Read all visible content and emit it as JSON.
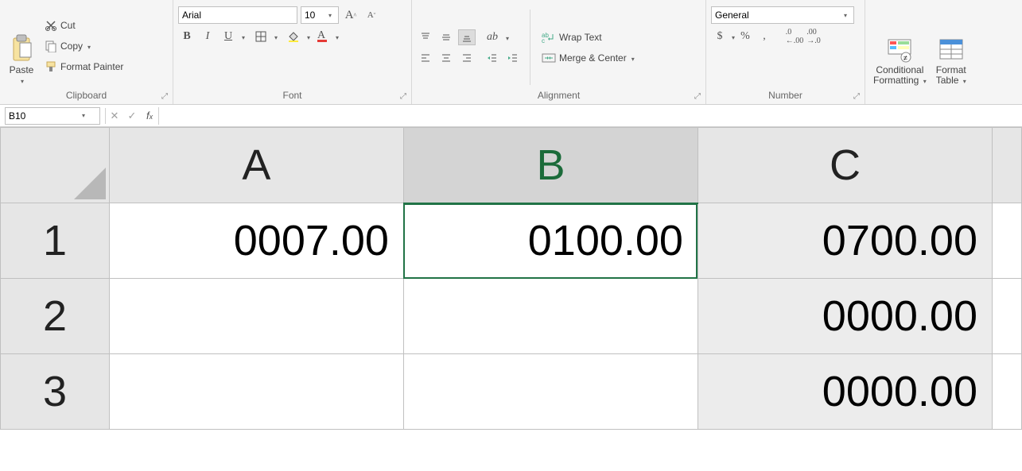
{
  "ribbon": {
    "clipboard": {
      "paste": "Paste",
      "cut": "Cut",
      "copy": "Copy",
      "format_painter": "Format Painter",
      "group_label": "Clipboard"
    },
    "font": {
      "font_name": "Arial",
      "font_size": "10",
      "group_label": "Font"
    },
    "alignment": {
      "wrap": "Wrap Text",
      "merge": "Merge & Center",
      "group_label": "Alignment"
    },
    "number": {
      "format": "General",
      "currency": "$",
      "percent": "%",
      "comma": ",",
      "group_label": "Number"
    },
    "styles": {
      "conditional": "Conditional\nFormatting",
      "format_table": "Format\nTable"
    }
  },
  "name_box": "B10",
  "formula": "",
  "columns": [
    "A",
    "B",
    "C"
  ],
  "rows": [
    "1",
    "2",
    "3"
  ],
  "cells": {
    "A1": "0007.00",
    "B1": "0100.00",
    "C1": "0700.00",
    "A2": "",
    "B2": "",
    "C2": "0000.00",
    "A3": "",
    "B3": "",
    "C3": "0000.00"
  },
  "active_column": "B"
}
